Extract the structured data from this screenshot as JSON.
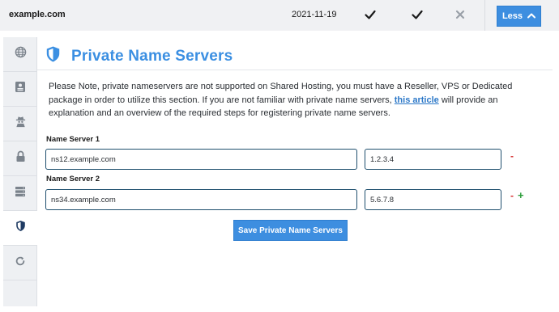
{
  "domain_row": {
    "domain": "example.com",
    "date": "2021-11-19",
    "less_label": "Less"
  },
  "icons": {
    "row_status_1": "check-icon",
    "row_status_2": "check-icon",
    "row_status_3": "x-icon",
    "less_chevron": "chevron-up-icon",
    "side_tabs": [
      "globe-icon",
      "address-card-icon",
      "user-secret-icon",
      "lock-icon",
      "server-icon",
      "shield-icon",
      "refresh-icon"
    ],
    "title": "shield-icon"
  },
  "panel": {
    "title": "Private Name Servers",
    "description_before_link": "Please Note, private nameservers are not supported on Shared Hosting, you must have a Reseller, VPS or Dedicated package in order to utilize this section. If you are not familiar with private name servers, ",
    "link_text": "this article",
    "description_after_link": " will provide an explanation and an overview of the required steps for registering private name servers."
  },
  "name_servers": [
    {
      "label": "Name Server 1",
      "hostname": "ns12.example.com",
      "ip": "1.2.3.4",
      "remove": "-"
    },
    {
      "label": "Name Server 2",
      "hostname": "ns34.example.com",
      "ip": "5.6.7.8",
      "remove": "-",
      "add": "+"
    }
  ],
  "save_label": "Save Private Name Servers",
  "colors": {
    "accent": "#3b8fe2",
    "button": "#3d8ee0",
    "remove": "#d62b2b",
    "add": "#2b9d3a"
  }
}
